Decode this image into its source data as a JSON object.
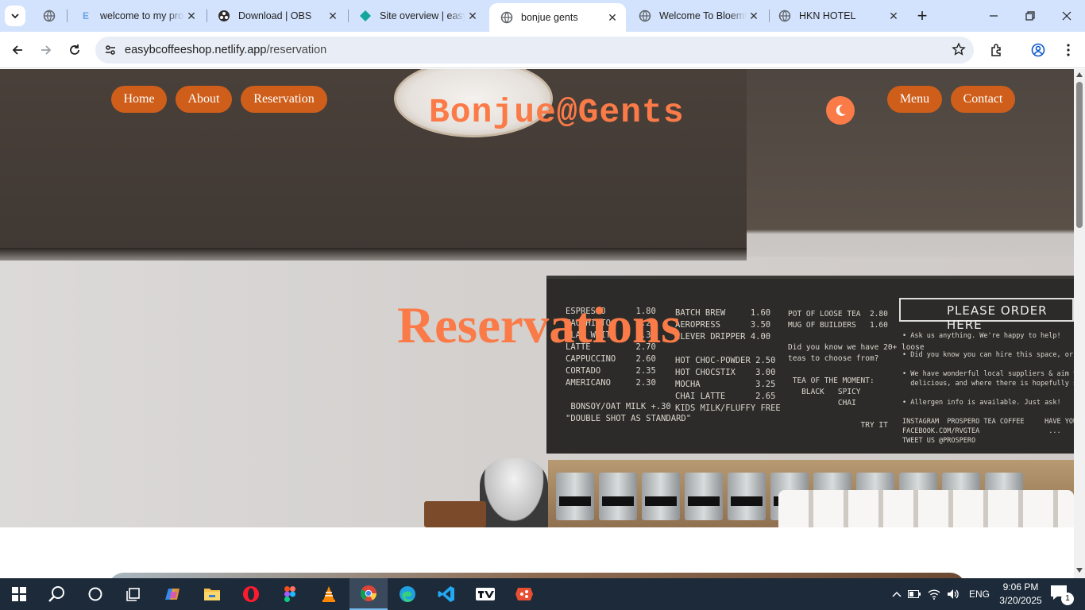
{
  "browser": {
    "tabs": [
      {
        "title": "",
        "icon": "globe-icon"
      },
      {
        "title": "welcome to my project",
        "icon": "page-icon"
      },
      {
        "title": "Download | OBS",
        "icon": "obs-icon"
      },
      {
        "title": "Site overview | easybcoffeeshop",
        "icon": "netlify-icon"
      },
      {
        "title": "bonjue gents",
        "icon": "globe-icon",
        "active": true
      },
      {
        "title": "Welcome To Bloemfontein",
        "icon": "globe-icon"
      },
      {
        "title": "HKN HOTEL",
        "icon": "globe-icon"
      }
    ],
    "address": {
      "domain": "easybcoffeeshop.netlify.app",
      "path": "/reservation"
    }
  },
  "site": {
    "nav_left": [
      "Home",
      "About",
      "Reservation"
    ],
    "brand": "Bonjue@Gents",
    "nav_right": [
      "Menu",
      "Contact"
    ],
    "hero_title": "Reservations",
    "accent_color": "#fb7b48",
    "pill_color": "#cf5e1a"
  },
  "chalkboard": {
    "col1": "ESPRESSO      1.80\nMACCHIATO     2.20\nFLAT WHITE    2.30\nLATTE         2.70\nCAPPUCCINO    2.60\nCORTADO       2.35\nAMERICANO     2.30\n\n BONSOY/OAT MILK +.30\n\"DOUBLE SHOT AS STANDARD\"",
    "col2": "BATCH BREW     1.60\nAEROPRESS      3.50\nCLEVER DRIPPER 4.00\n\nHOT CHOC-POWDER 2.50\nHOT CHOCSTIX    3.00\nMOCHA           3.25\nCHAI LATTE      2.65\nKIDS MILK/FLUFFY FREE",
    "col3": "POT OF LOOSE TEA  2.80\nMUG OF BUILDERS   1.60\n\nDid you know we have 20+ loose\nteas to choose from?\n\n TEA OF THE MOMENT:\n   BLACK   SPICY\n           CHAI\n\n                TRY IT",
    "banner": "PLEASE ORDER HERE",
    "col4": "• Ask us anything. We're happy to help!\n\n• Did you know you can hire this space, or our downstairs?\n\n• We have wonderful local suppliers & aim to create, for\n  delicious, and where there is hopefully something for everyone\n\n• Allergen info is available. Just ask!\n\nINSTAGRAM  PROSPERO TEA COFFEE     HAVE YOU VISITED\nFACEBOOK.COM/RVGTEA                 ...\nTWEET US @PROSPERO"
  },
  "taskbar": {
    "apps": [
      "start-icon",
      "search-icon",
      "cortana-icon",
      "task-view-icon",
      "copilot-icon",
      "file-explorer-icon",
      "opera-icon",
      "figma-icon",
      "vlc-icon",
      "chrome-icon",
      "edge-icon",
      "vscode-icon",
      "tradingview-icon",
      "git-icon"
    ],
    "language": "ENG",
    "time": "9:06 PM",
    "date": "3/20/2025",
    "notifications": "1"
  }
}
